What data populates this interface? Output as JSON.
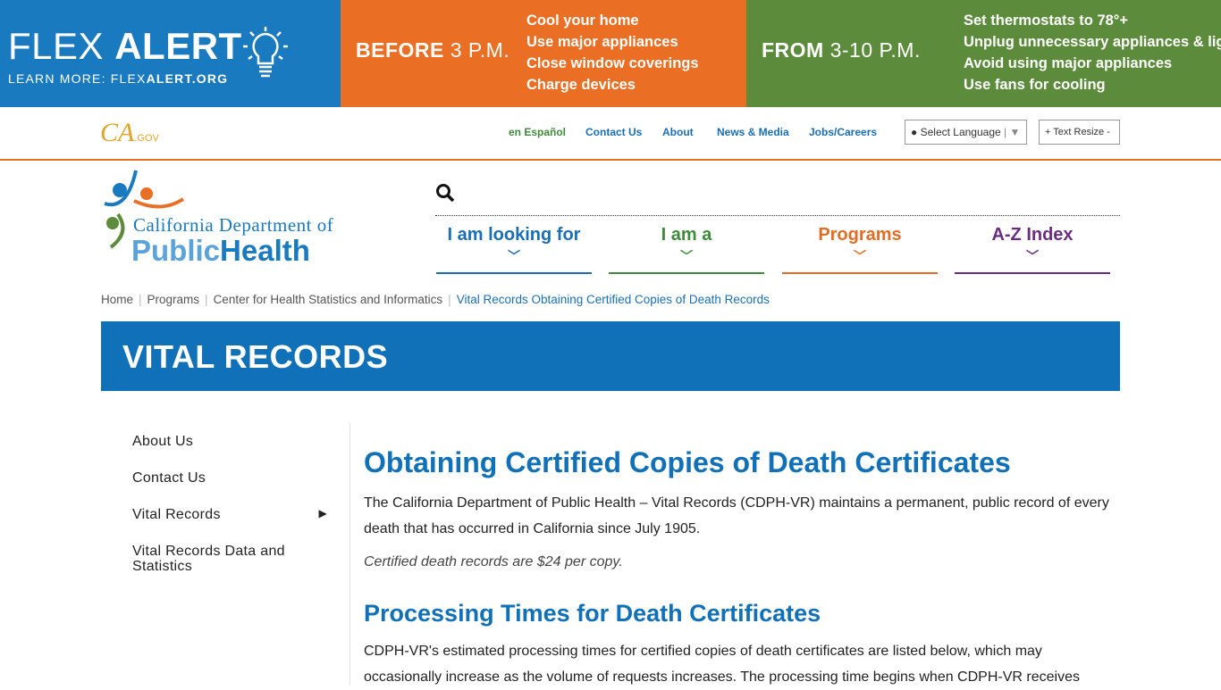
{
  "banner": {
    "title_light": "FLEX ",
    "title_bold": "ALERT",
    "learn_prefix": "LEARN MORE: FLEX",
    "learn_bold": "ALERT.ORG",
    "before_bold": "BEFORE",
    "before_light": " 3 P.M.",
    "before_tips": [
      "Cool your home",
      "Use major appliances",
      "Close window coverings",
      "Charge devices"
    ],
    "from_bold": "FROM",
    "from_light": " 3-10 P.M.",
    "from_tips": [
      "Set thermostats to 78°+",
      "Unplug unnecessary appliances & lights",
      "Avoid using major appliances",
      "Use fans for cooling"
    ],
    "colors": {
      "blue": "#1a7abf",
      "orange": "#ea6f24",
      "green": "#5c8c3b"
    }
  },
  "utility": {
    "cagov": "CA",
    "cagov_small": ".GOV",
    "links": [
      "en Español",
      "Contact Us",
      "About",
      "News & Media",
      "Jobs/Careers"
    ],
    "language": "Select Language",
    "text_resize": "+ Text Resize -"
  },
  "logo": {
    "line1": "California Department of",
    "line2a": "Public",
    "line2b": "Health"
  },
  "nav": [
    {
      "label": "I am looking for",
      "color": "#1a6fb4"
    },
    {
      "label": "I am a",
      "color": "#3e8b3a"
    },
    {
      "label": "Programs",
      "color": "#e36c24"
    },
    {
      "label": "A-Z Index",
      "color": "#6b2c81"
    }
  ],
  "breadcrumb": [
    "Home",
    "Programs",
    "Center for Health Statistics and Informatics",
    "Vital Records Obtaining Certified Copies of Death Records"
  ],
  "hero": {
    "title": "VITAL RECORDS"
  },
  "sidebar": [
    "About Us",
    "Contact Us",
    "Vital Records",
    "Vital Records Data and Statistics"
  ],
  "main": {
    "h1": "Obtaining Certified Copies of Death Certificates",
    "p1": "The California Department of Public Health – Vital Records (CDPH-VR) maintains a permanent, public record of every death that has occurred in California since July 1905.",
    "p2": "Certified death records are $24 per copy.",
    "h2": "Processing Times for Death Certificates",
    "p3": "CDPH-VR's estimated processing times for certified copies of death certificates are listed below, which may occasionally increase as the volume of requests increases. The processing time begins when CDPH-VR receives"
  }
}
